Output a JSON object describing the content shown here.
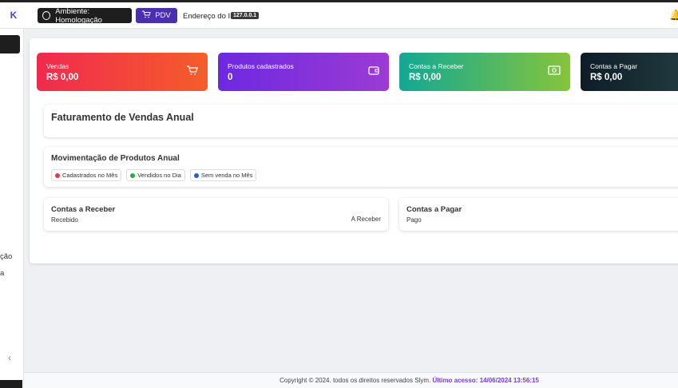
{
  "header": {
    "collapse_label": "K",
    "env_label": "Ambiente: Homologação",
    "pdv_label": "PDV",
    "ip_label": "Endereço do IP:",
    "ip_value": "127.0.0.1"
  },
  "sidebar": {
    "items": [
      {
        "label": "ção"
      },
      {
        "label": "a"
      }
    ],
    "chevron": "‹"
  },
  "cards": [
    {
      "label": "Vendas",
      "value": "R$ 0,00",
      "icon": "cart-icon"
    },
    {
      "label": "Produtos cadastrados",
      "value": "0",
      "icon": "wallet-icon"
    },
    {
      "label": "Contas a Receber",
      "value": "R$ 0,00",
      "icon": "money-icon"
    },
    {
      "label": "Contas a Pagar",
      "value": "R$ 0,00",
      "icon": "none"
    }
  ],
  "revenue": {
    "title": "Faturamento de Vendas Anual"
  },
  "movement": {
    "title": "Movimentação de Produtos Anual",
    "legend": [
      {
        "label": "Cadastrados no Mês",
        "color": "#e03a4a"
      },
      {
        "label": "Vendidos no Dia",
        "color": "#2aa84a"
      },
      {
        "label": "Sem venda no Mês",
        "color": "#2a5bd7"
      }
    ]
  },
  "receivable": {
    "title": "Contas a Receber",
    "left": "Recebido",
    "right": "A Receber"
  },
  "payable": {
    "title": "Contas a Pagar",
    "left": "Pago"
  },
  "footer": {
    "copyright": "Copyright © 2024. todos os direitos reservados Slym.",
    "last_access": "Último acesso: 14/06/2024 13:56:15"
  }
}
